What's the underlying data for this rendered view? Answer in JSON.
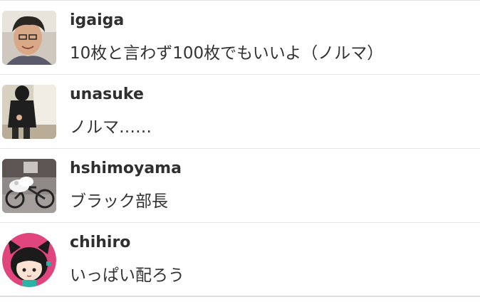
{
  "comments": [
    {
      "username": "igaiga",
      "message": "10枚と言わず100枚でもいいよ（ノルマ）",
      "avatar_icon": "user-photo-icon"
    },
    {
      "username": "unasuke",
      "message": "ノルマ……",
      "avatar_icon": "user-photo-icon"
    },
    {
      "username": "hshimoyama",
      "message": "ブラック部長",
      "avatar_icon": "bicycle-photo-icon"
    },
    {
      "username": "chihiro",
      "message": "いっぱい配ろう",
      "avatar_icon": "cat-ear-character-icon"
    }
  ],
  "colors": {
    "divider": "#e4e4e4",
    "username": "#2f2f2f",
    "message": "#333333",
    "chihiro_avatar_bg": "#e0457e"
  }
}
